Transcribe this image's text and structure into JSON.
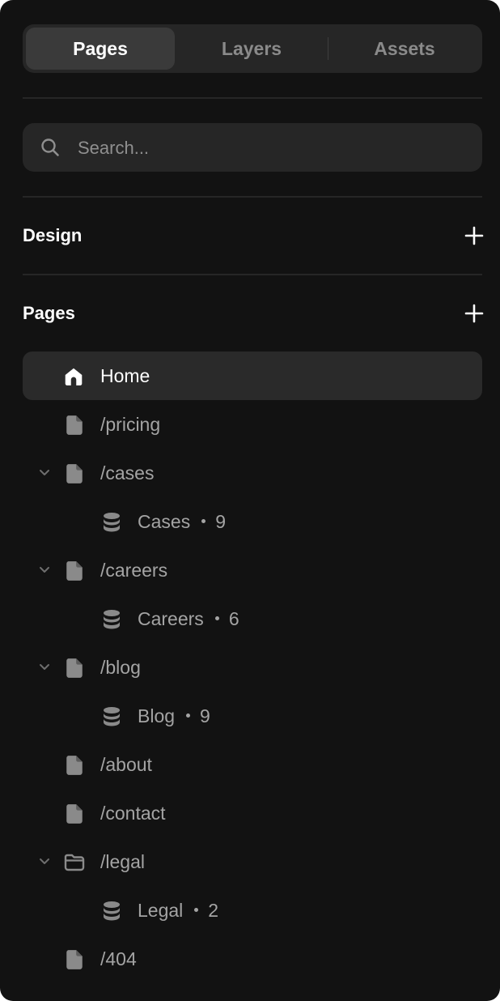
{
  "tabs": [
    {
      "label": "Pages",
      "active": true
    },
    {
      "label": "Layers",
      "active": false
    },
    {
      "label": "Assets",
      "active": false
    }
  ],
  "search": {
    "placeholder": "Search...",
    "value": "",
    "icon": "search-icon"
  },
  "sections": {
    "design": {
      "title": "Design",
      "icon": "plus-icon"
    },
    "pages": {
      "title": "Pages",
      "icon": "plus-icon"
    }
  },
  "tree": [
    {
      "label": "Home",
      "icon": "home-icon",
      "active": true,
      "expandable": false,
      "level": 0
    },
    {
      "label": "/pricing",
      "icon": "page-icon",
      "expandable": false,
      "level": 0
    },
    {
      "label": "/cases",
      "icon": "page-icon",
      "expandable": true,
      "level": 0
    },
    {
      "label": "Cases",
      "count": "9",
      "icon": "collection-icon",
      "level": 1
    },
    {
      "label": "/careers",
      "icon": "page-icon",
      "expandable": true,
      "level": 0
    },
    {
      "label": "Careers",
      "count": "6",
      "icon": "collection-icon",
      "level": 1
    },
    {
      "label": "/blog",
      "icon": "page-icon",
      "expandable": true,
      "level": 0
    },
    {
      "label": "Blog",
      "count": "9",
      "icon": "collection-icon",
      "level": 1
    },
    {
      "label": "/about",
      "icon": "page-icon",
      "expandable": false,
      "level": 0
    },
    {
      "label": "/contact",
      "icon": "page-icon",
      "expandable": false,
      "level": 0
    },
    {
      "label": "/legal",
      "icon": "folder-icon",
      "expandable": true,
      "level": 0
    },
    {
      "label": "Legal",
      "count": "2",
      "icon": "collection-icon",
      "level": 1
    },
    {
      "label": "/404",
      "icon": "page-icon",
      "expandable": false,
      "level": 0
    }
  ],
  "colors": {
    "panel_bg": "#121212",
    "surface": "#262626",
    "active_row": "#2a2a2a",
    "text_primary": "#ffffff",
    "text_muted": "#a4a4a4",
    "icon_muted": "#8a8a8a"
  }
}
